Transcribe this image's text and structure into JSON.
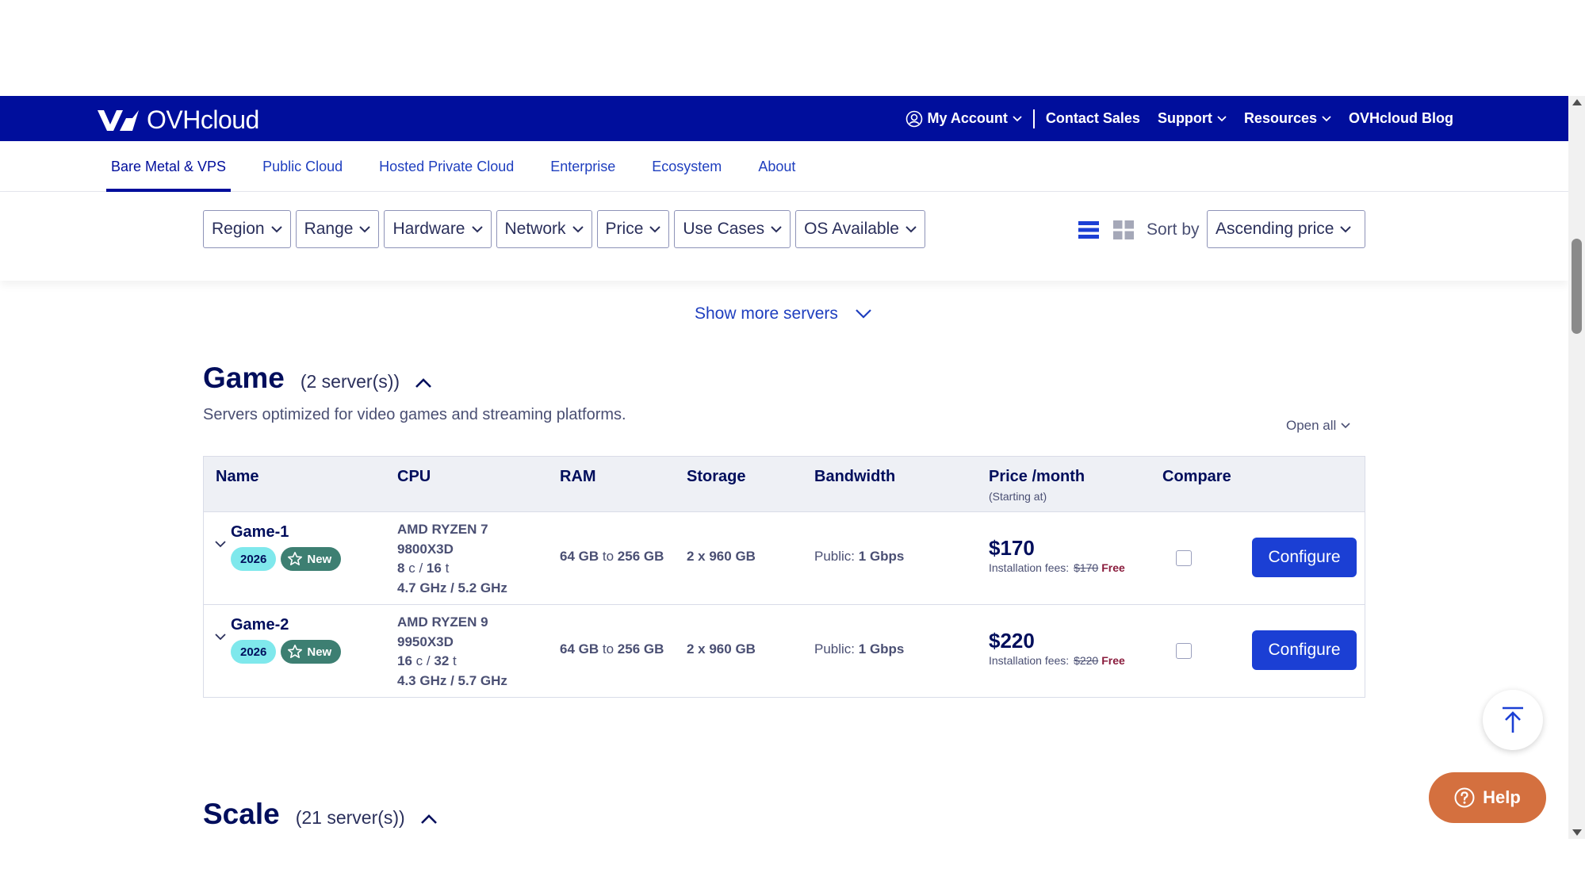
{
  "brand": {
    "name": "OVHcloud"
  },
  "topnav": {
    "my_account": "My Account",
    "contact_sales": "Contact Sales",
    "support": "Support",
    "resources": "Resources",
    "blog": "OVHcloud Blog"
  },
  "subnav": {
    "tabs": [
      "Bare Metal & VPS",
      "Public Cloud",
      "Hosted Private Cloud",
      "Enterprise",
      "Ecosystem",
      "About"
    ],
    "active": "Bare Metal & VPS"
  },
  "filters": {
    "buttons": [
      "Region",
      "Range",
      "Hardware",
      "Network",
      "Price",
      "Use Cases",
      "OS Available"
    ],
    "sort_label": "Sort by",
    "sort_value": "Ascending price"
  },
  "show_more": "Show more servers",
  "game": {
    "title": "Game",
    "count": "(2 server(s))",
    "description": "Servers optimized for video games and streaming platforms.",
    "open_all": "Open all",
    "columns": {
      "name": "Name",
      "cpu": "CPU",
      "ram": "RAM",
      "storage": "Storage",
      "bandwidth": "Bandwidth",
      "price": "Price /month",
      "price_sub": "(Starting at)",
      "compare": "Compare"
    },
    "rows": [
      {
        "name": "Game-1",
        "year": "2026",
        "badge": "New",
        "cpu_model_1": "AMD RYZEN 7",
        "cpu_model_2": "9800X3D",
        "cores": "8",
        "threads": "16",
        "freq": "4.7 GHz / 5.2 GHz",
        "ram_min": "64 GB",
        "ram_max": "256 GB",
        "storage": "2 x 960 GB",
        "bw_label": "Public:",
        "bw_value": "1 Gbps",
        "price": "$170",
        "fee_label": "Installation fees:",
        "fee_old": "$170",
        "fee_new": "Free",
        "configure": "Configure"
      },
      {
        "name": "Game-2",
        "year": "2026",
        "badge": "New",
        "cpu_model_1": "AMD RYZEN 9",
        "cpu_model_2": "9950X3D",
        "cores": "16",
        "threads": "32",
        "freq": "4.3 GHz / 5.7 GHz",
        "ram_min": "64 GB",
        "ram_max": "256 GB",
        "storage": "2 x 960 GB",
        "bw_label": "Public:",
        "bw_value": "1 Gbps",
        "price": "$220",
        "fee_label": "Installation fees:",
        "fee_old": "$220",
        "fee_new": "Free",
        "configure": "Configure"
      }
    ]
  },
  "scale": {
    "title": "Scale",
    "count": "(21 server(s))"
  },
  "common": {
    "c": "c",
    "t": "t",
    "slash": "/",
    "to": "to"
  },
  "help": "Help",
  "colors": {
    "nav_bg": "#000e9c",
    "accent": "#1b3fd4",
    "help": "#d4703f",
    "badge_year": "#7fe8ec",
    "badge_new": "#3d7f72"
  }
}
